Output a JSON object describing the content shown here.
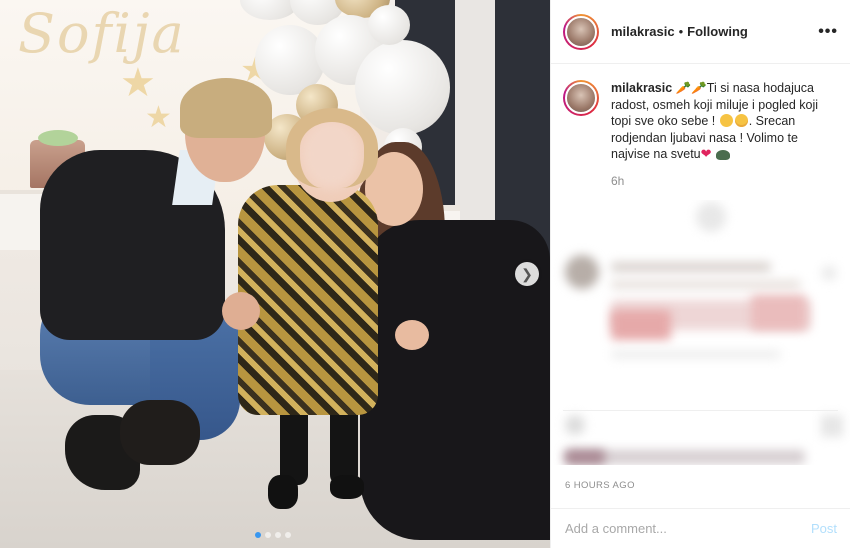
{
  "post": {
    "username": "milakrasic",
    "separator": "•",
    "follow_status": "Following",
    "more_icon": "more-horizontal-icon",
    "caption": {
      "username": "milakrasic",
      "text_part1": " 🥕🥕Ti si nasa hodajuca radost, osmeh koji miluje i pogled koji topi sve oko sebe ! ",
      "text_part2": ". Srecan rodjendan ljubavi nasa ! Volimo te najvise na svetu",
      "time": "6h"
    },
    "timestamp": "6 HOURS AGO",
    "comment_placeholder": "Add a comment...",
    "post_label": "Post"
  },
  "photo": {
    "backdrop_text": "Sofija",
    "next_icon": "chevron-right-icon",
    "carousel": {
      "count": 4,
      "active": 1
    }
  },
  "colors": {
    "accent": "#3897f0",
    "post_disabled": "#b2dffc",
    "muted": "#8e8e8e",
    "text": "#262626"
  }
}
